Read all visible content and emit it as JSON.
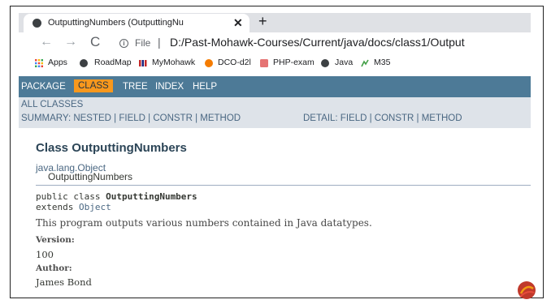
{
  "browser": {
    "tab_title": "OutputtingNumbers (OutputtingNu",
    "tab_close": "✕",
    "new_tab": "+",
    "nav_back": "←",
    "nav_forward": "→",
    "nav_reload": "C",
    "url_scheme_label": "File",
    "url_separator": "|",
    "url_path": "D:/Past-Mohawk-Courses/Current/java/docs/class1/Output",
    "bookmarks": [
      {
        "label": "Apps",
        "icon": "apps-grid-icon"
      },
      {
        "label": "RoadMap",
        "icon": "globe-icon"
      },
      {
        "label": "MyMohawk",
        "icon": "mohawk-bars-icon"
      },
      {
        "label": "DCO-d2l",
        "icon": "d2l-icon"
      },
      {
        "label": "PHP-exam",
        "icon": "php-icon"
      },
      {
        "label": "Java",
        "icon": "globe-icon"
      },
      {
        "label": "M35",
        "icon": "m-icon"
      }
    ]
  },
  "javadoc": {
    "navbar": {
      "items": [
        "PACKAGE",
        "CLASS",
        "TREE",
        "INDEX",
        "HELP"
      ],
      "active": "CLASS"
    },
    "all_classes": "ALL CLASSES",
    "summary_text": "SUMMARY: NESTED | FIELD | CONSTR | METHOD",
    "detail_text": "DETAIL: FIELD | CONSTR | METHOD",
    "class_title": "Class OutputtingNumbers",
    "inheritance": [
      "java.lang.Object",
      "OutputtingNumbers"
    ],
    "signature_prefix": "public class ",
    "signature_name": "OutputtingNumbers",
    "extends_prefix": "extends ",
    "extends_name": "Object",
    "description": "This program outputs various numbers contained in Java datatypes.",
    "version_label": "Version:",
    "version_value": "100",
    "author_label": "Author:",
    "author_value": "James Bond"
  },
  "colors": {
    "navbar_bg": "#4d7a97",
    "active_bg": "#f8981d",
    "subnav_bg": "#dee3e9",
    "title_color": "#2c4557",
    "link_color": "#4a6782",
    "logo_color": "#c0392b"
  }
}
